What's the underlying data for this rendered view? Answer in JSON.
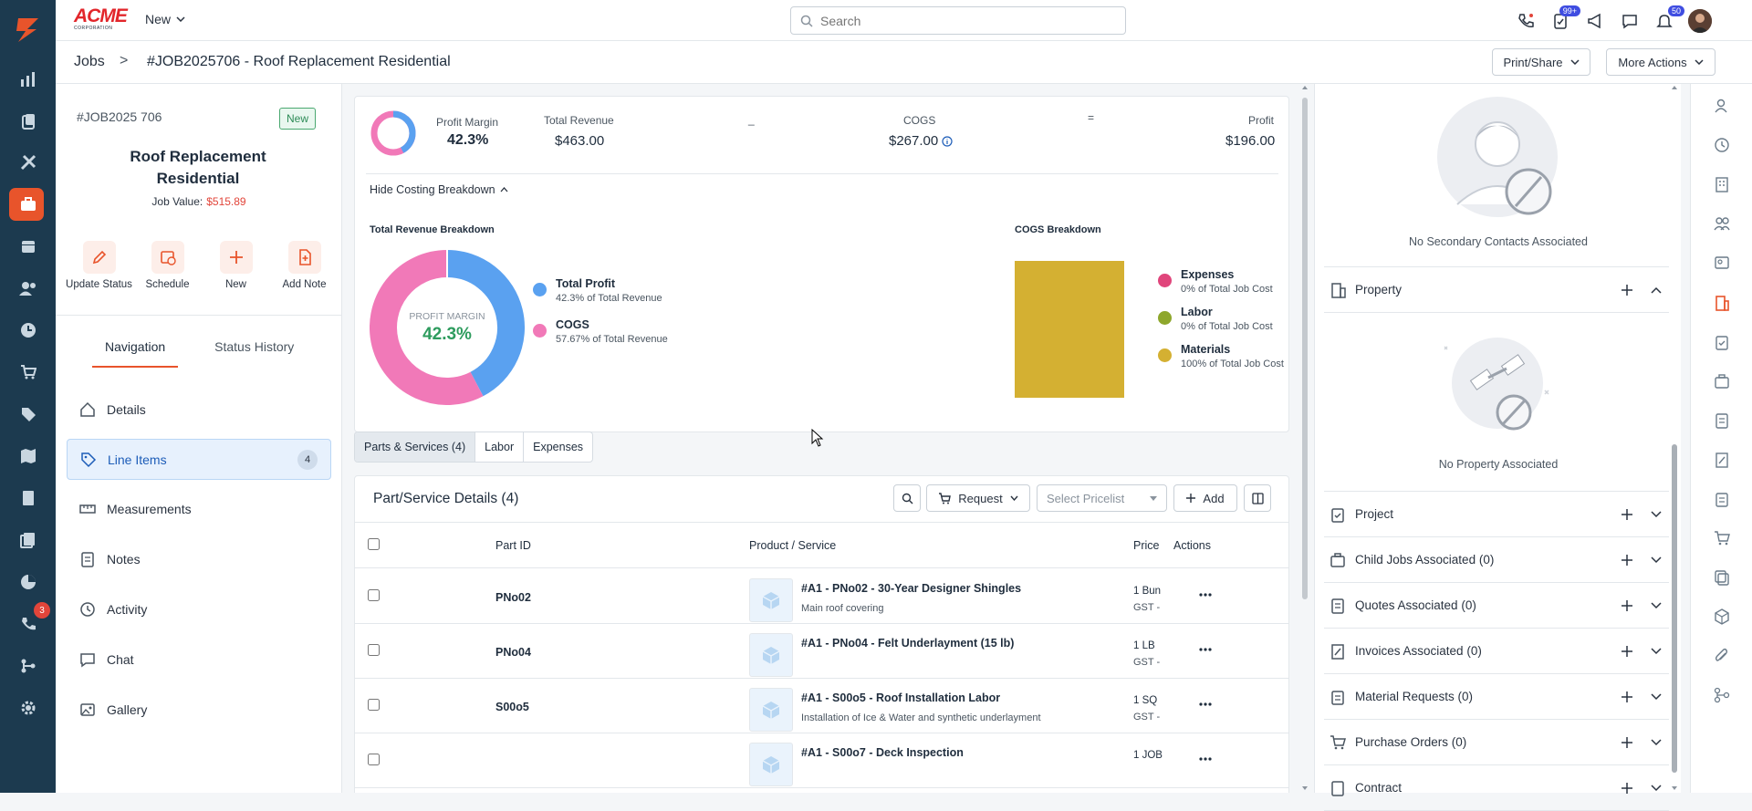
{
  "app": {
    "name": "ACME Corporation"
  },
  "colors": {
    "accent": "#e8542b",
    "sidebar": "#1c3a4f",
    "link": "#1d5db8",
    "revenue": "#5aa1f0",
    "cogs": "#f179b8",
    "materials": "#d4b032",
    "expenses": "#e0457b",
    "labor": "#8ea72c"
  },
  "topbar": {
    "brand_text": "ACME",
    "brand_sub": "CORPORATION",
    "new_label": "New",
    "search_placeholder": "Search",
    "tasks_badge": "99+",
    "notif_badge": "50"
  },
  "leftbar": {
    "calls_badge": "3"
  },
  "breadcrumb": {
    "root": "Jobs",
    "sep": ">",
    "title": "#JOB2025706 - Roof Replacement Residential"
  },
  "header_actions": {
    "print": "Print/Share",
    "more": "More Actions"
  },
  "job": {
    "number": "#JOB2025 706",
    "status": "New",
    "title": "Roof Replacement Residential",
    "value_label": "Job Value:",
    "value": "$515.89"
  },
  "quick_actions": [
    {
      "label": "Update Status",
      "icon": "pencil-icon"
    },
    {
      "label": "Schedule",
      "icon": "calendar-clock-icon"
    },
    {
      "label": "New",
      "icon": "plus-icon"
    },
    {
      "label": "Add Note",
      "icon": "note-add-icon"
    }
  ],
  "left_tabs": {
    "nav": "Navigation",
    "history": "Status History"
  },
  "nav": [
    {
      "label": "Details",
      "icon": "home-icon"
    },
    {
      "label": "Line Items",
      "icon": "tag-icon",
      "count": "4",
      "active": true
    },
    {
      "label": "Measurements",
      "icon": "ruler-icon"
    },
    {
      "label": "Notes",
      "icon": "notes-icon"
    },
    {
      "label": "Activity",
      "icon": "clock-icon"
    },
    {
      "label": "Chat",
      "icon": "chat-icon"
    },
    {
      "label": "Gallery",
      "icon": "gallery-icon"
    }
  ],
  "summary": {
    "margin_label": "Profit Margin",
    "margin_value": "42.3%",
    "revenue_label": "Total Revenue",
    "revenue_value": "$463.00",
    "minus": "_",
    "cogs_label": "COGS",
    "cogs_value": "$267.00",
    "equals": "=",
    "profit_label": "Profit",
    "profit_value": "$196.00",
    "toggle": "Hide Costing Breakdown"
  },
  "revenue_breakdown": {
    "title": "Total Revenue Breakdown",
    "center_label": "PROFIT MARGIN",
    "center_value": "42.3%",
    "legend": [
      {
        "name": "Total Profit",
        "desc": "42.3% of Total Revenue",
        "color": "#5aa1f0"
      },
      {
        "name": "COGS",
        "desc": "57.67% of Total Revenue",
        "color": "#f179b8"
      }
    ]
  },
  "cogs_breakdown": {
    "title": "COGS Breakdown",
    "legend": [
      {
        "name": "Expenses",
        "desc": "0% of Total Job Cost",
        "color": "#e0457b"
      },
      {
        "name": "Labor",
        "desc": "0% of Total Job Cost",
        "color": "#8ea72c"
      },
      {
        "name": "Materials",
        "desc": "100% of Total Job Cost",
        "color": "#d4b032"
      }
    ]
  },
  "chart_data": [
    {
      "type": "pie",
      "title": "Total Revenue Breakdown",
      "categories": [
        "Total Profit",
        "COGS"
      ],
      "values": [
        42.3,
        57.67
      ],
      "center_label": "PROFIT MARGIN 42.3%"
    },
    {
      "type": "bar",
      "title": "COGS Breakdown",
      "categories": [
        "Expenses",
        "Labor",
        "Materials"
      ],
      "values": [
        0,
        0,
        100
      ],
      "stacked": true
    }
  ],
  "subtabs": {
    "parts": "Parts & Services (4)",
    "labor": "Labor",
    "expenses": "Expenses"
  },
  "parts": {
    "title": "Part/Service Details (4)",
    "request": "Request",
    "pricelist_placeholder": "Select Pricelist",
    "add": "Add",
    "columns": {
      "part_id": "Part ID",
      "product": "Product / Service",
      "price": "Price",
      "actions": "Actions"
    },
    "rows": [
      {
        "id": "PNo02",
        "name": "#A1 - PNo02 - 30-Year Designer Shingles",
        "desc": "Main roof covering",
        "qty": "1 Bun",
        "tax": "GST -"
      },
      {
        "id": "PNo04",
        "name": "#A1 - PNo04 - Felt Underlayment (15 lb)",
        "desc": "",
        "qty": "1 LB",
        "tax": "GST -"
      },
      {
        "id": "S00o5",
        "name": "#A1 - S00o5 - Roof Installation Labor",
        "desc": "Installation of Ice & Water and synthetic underlayment",
        "qty": "1 SQ",
        "tax": "GST -"
      },
      {
        "id": "",
        "name": "#A1 - S00o7 - Deck Inspection",
        "desc": "",
        "qty": "1 JOB",
        "tax": ""
      }
    ]
  },
  "right": {
    "no_secondary": "No Secondary Contacts Associated",
    "property_title": "Property",
    "no_property": "No Property Associated",
    "sections": [
      {
        "label": "Project",
        "icon": "clipboard-check-icon"
      },
      {
        "label": "Child Jobs Associated (0)",
        "icon": "briefcase-icon"
      },
      {
        "label": "Quotes Associated (0)",
        "icon": "quote-doc-icon"
      },
      {
        "label": "Invoices Associated (0)",
        "icon": "invoice-icon"
      },
      {
        "label": "Material Requests (0)",
        "icon": "clipboard-list-icon"
      },
      {
        "label": "Purchase Orders (0)",
        "icon": "cart-icon"
      },
      {
        "label": "Contract",
        "icon": "contract-icon"
      }
    ]
  }
}
